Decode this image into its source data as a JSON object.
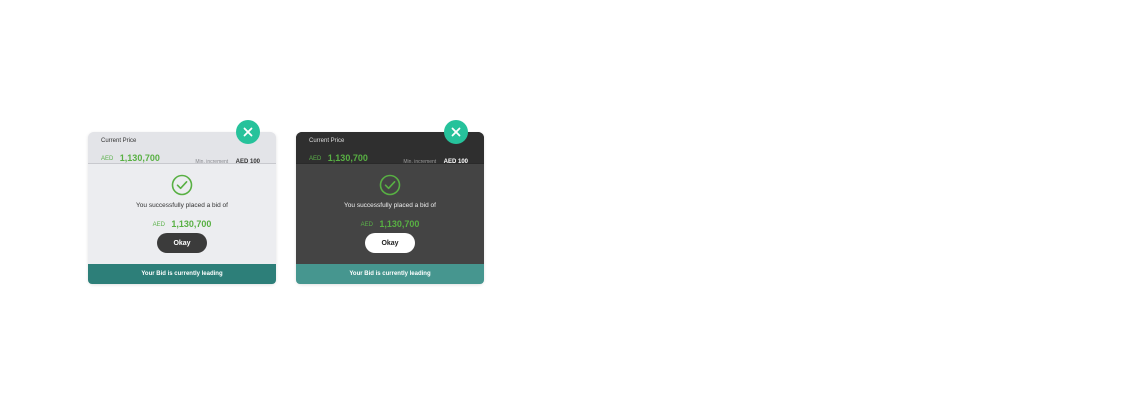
{
  "colors": {
    "accent_green": "#58b043",
    "close_button": "#26c29b",
    "footer_light": "#2d7f79",
    "footer_dark": "#46968f",
    "light_bg": "#ecedf0",
    "dark_bg": "#444444"
  },
  "dialogs": [
    {
      "theme": "light",
      "header": {
        "current_price_label": "Current Price",
        "currency": "AED",
        "current_price": "1,130,700",
        "min_increment_label": "Min. increment",
        "min_increment_value": "AED 100"
      },
      "icon": "check-circle-icon",
      "message": "You successfully placed a bid of",
      "bid_currency": "AED",
      "bid_amount": "1,130,700",
      "okay_label": "Okay",
      "footer_text": "Your Bid is currently leading",
      "close_icon": "close-icon"
    },
    {
      "theme": "dark",
      "header": {
        "current_price_label": "Current Price",
        "currency": "AED",
        "current_price": "1,130,700",
        "min_increment_label": "Min. increment",
        "min_increment_value": "AED 100"
      },
      "icon": "check-circle-icon",
      "message": "You successfully placed a bid of",
      "bid_currency": "AED",
      "bid_amount": "1,130,700",
      "okay_label": "Okay",
      "footer_text": "Your Bid is currently leading",
      "close_icon": "close-icon"
    }
  ]
}
